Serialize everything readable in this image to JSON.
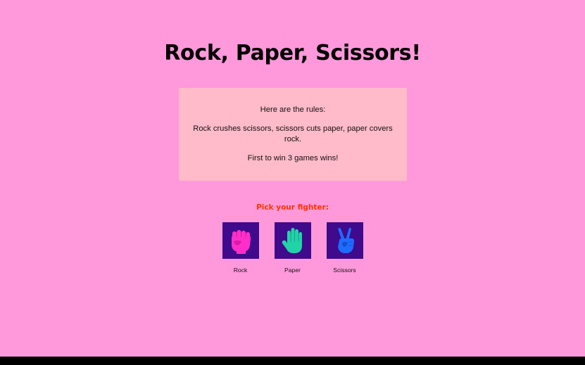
{
  "title": "Rock, Paper, Scissors!",
  "rules": {
    "intro": "Here are the rules:",
    "text": "Rock crushes scissors, scissors cuts paper, paper covers rock.",
    "win_condition": "First to win 3 games wins!"
  },
  "pick_label": "Pick your fighter:",
  "fighters": [
    {
      "label": "Rock",
      "icon": "fist-icon",
      "color": "#ff2ec8"
    },
    {
      "label": "Paper",
      "icon": "open-hand-icon",
      "color": "#22d3a8"
    },
    {
      "label": "Scissors",
      "icon": "peace-hand-icon",
      "color": "#1e6bff"
    }
  ],
  "colors": {
    "background": "#ff99db",
    "rules_box": "#ffbbc9",
    "pick_label": "#ff3300",
    "tile": "#3f0a8c"
  }
}
